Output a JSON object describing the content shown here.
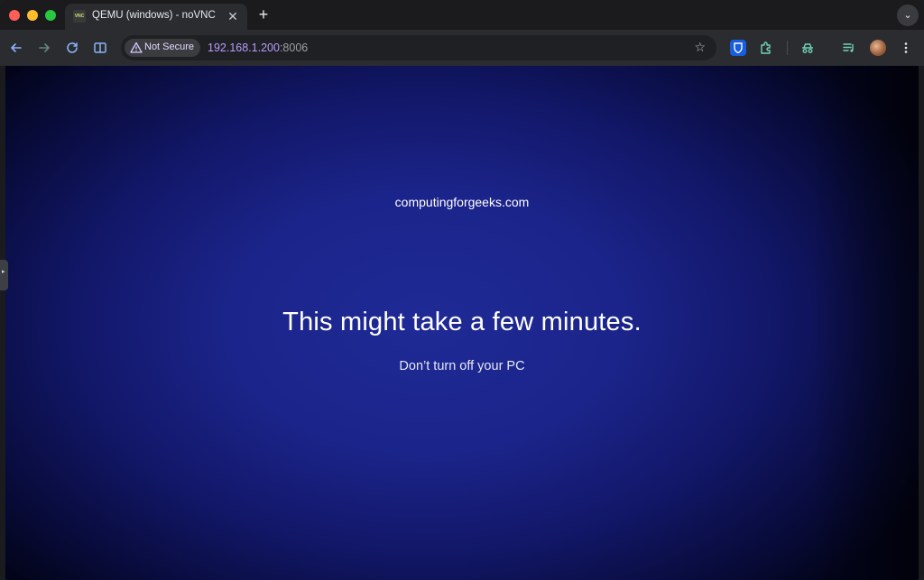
{
  "browser": {
    "tab": {
      "title": "QEMU (windows) - noVNC",
      "favicon_text": "VNC",
      "close_icon": "close-icon"
    },
    "toolbar": {
      "security_label": "Not Secure",
      "url_host": "192.168.1.200",
      "url_port": ":8006"
    },
    "icons": [
      "back-icon",
      "forward-icon",
      "reload-icon",
      "split-view-icon",
      "warning-icon",
      "star-icon",
      "bitwarden-icon",
      "extensions-icon",
      "incognito-icon",
      "media-control-icon",
      "avatar",
      "more-menu-icon",
      "new-tab-icon",
      "tab-search-icon"
    ]
  },
  "vnc_screen": {
    "brand": "computingforgeeks.com",
    "headline": "This might take a few minutes.",
    "subline": "Don’t turn off your PC"
  },
  "colors": {
    "background_center": "#1f2a96",
    "background_edge": "#03041a",
    "url_host": "#b99cff"
  }
}
